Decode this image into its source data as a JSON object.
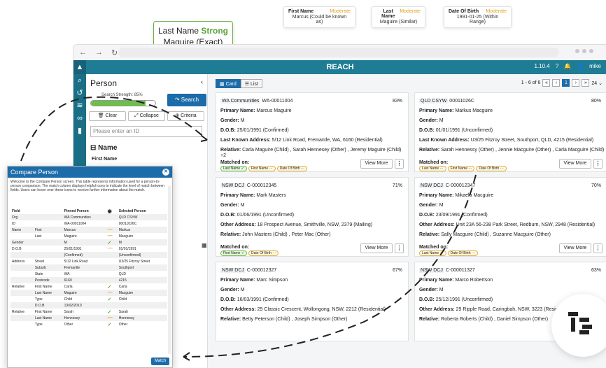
{
  "callouts": {
    "first_name": {
      "label": "First Name",
      "level": "Moderate",
      "value": "Marcus (Could be known as)"
    },
    "last_name": {
      "label": "Last Name",
      "level": "Moderate",
      "value": "Maguire    (Similar)"
    },
    "dob": {
      "label": "Date Of Birth",
      "level": "Moderate",
      "value": "1991-01-25 (Within Range)"
    },
    "last_name_strong": {
      "label": "Last Name",
      "level": "Strong",
      "value": "Maguire    (Exact)"
    }
  },
  "app": {
    "title": "REACH",
    "version": "1.10.4",
    "user": "mike",
    "accent": "#1e7d95"
  },
  "person_panel": {
    "title": "Person",
    "search_strength_label": "Search Strength: 85%",
    "search_strength": 85,
    "search_label": "Search",
    "clear_label": "Clear",
    "collapse_label": "Collapse",
    "criteria_label": "Criteria",
    "id_placeholder": "Please enter an ID",
    "name_section": "Name",
    "first_name_label": "First Name"
  },
  "results": {
    "card_label": "Card",
    "list_label": "List",
    "range": "1 - 6 of 6",
    "page": "1",
    "per_page": "24",
    "view_more": "View More",
    "matched_on": "Matched on:",
    "cards": [
      {
        "org": "WA Communities",
        "id": "WA-00011004",
        "pct": "83%",
        "primary": "Marcus Maguire",
        "gender": "M",
        "dob": "25/01/1991 (Confirmed)",
        "addr_label": "Last Known Address:",
        "addr": "5/12 Link Road, Fremantle, WA, 6160 (Residential)",
        "relative": "Carla Maguire (Child) , Sarah Hennesey (Other) , Jeremy Maguire (Child) +2",
        "chips": [
          "Last Name ✓",
          "First Name ⋯",
          "Date Of Birth ⋯"
        ]
      },
      {
        "org": "QLD CSYW",
        "id": "00011026C",
        "pct": "80%",
        "primary": "Markus Macguire",
        "gender": "M",
        "dob": "01/01/1991 (Unconfirmed)",
        "addr_label": "Last Known Address:",
        "addr": "U3/25 Fitzroy Street, Southport, QLD, 4215 (Residential)",
        "relative": "Sarah Hennessy (Other) , Jennie Macguire (Other) , Carla Macguire (Child)",
        "chips": [
          "Last Name ⋯",
          "First Name ⋯",
          "Date Of Birth ⋯"
        ]
      },
      {
        "org": "NSW DCJ",
        "id": "C-000012345",
        "pct": "71%",
        "primary": "Mark Masters",
        "gender": "M",
        "dob": "01/06/1991 (Unconfirmed)",
        "addr_label": "Other Address:",
        "addr": "18 Prospect Avenue, Smithville, NSW, 2379 (Mailing)",
        "relative": "John Masters (Child) , Peter Mac (Other)",
        "chips": [
          "First Name ✓",
          "Date Of Birth ⋯"
        ]
      },
      {
        "org": "NSW DCJ",
        "id": "C-000012347",
        "pct": "70%",
        "primary": "Mikaela Macguire",
        "gender": "M",
        "dob": "23/09/1991 (Confirmed)",
        "addr_label": "Other Address:",
        "addr": "Unit 23A 56-238 Park Street, Redburn, NSW, 2948 (Residential)",
        "relative": "Sally Macguire (Child) , Suzanne Macguire (Other)",
        "chips": [
          "Last Name ⋯",
          "Date Of Birth ⋯"
        ]
      },
      {
        "org": "NSW DCJ",
        "id": "C-000012327",
        "pct": "67%",
        "primary": "Marc Simpson",
        "gender": "M",
        "dob": "16/03/1991 (Confirmed)",
        "addr_label": "Other Address:",
        "addr": "29 Classic Crescent, Wollongong, NSW, 2212 (Residential)",
        "relative": "Betty Peterson (Child) , Joseph Simpson (Other)",
        "chips": []
      },
      {
        "org": "NSW DCJ",
        "id": "C-000011327",
        "pct": "63%",
        "primary": "Marco Robertson",
        "gender": "M",
        "dob": "25/12/1991 (Unconfirmed)",
        "addr_label": "Other Address:",
        "addr": "29 Ripple Road, Caringbah, NSW, 3223 (Residential)",
        "relative": "Roberta Roberts (Child) , Daniel Simpson (Other)",
        "chips": []
      }
    ]
  },
  "compare": {
    "title": "Compare Person",
    "intro": "Welcome to the Compare Person screen. This table represents information used for a person-to-person comparison. The match column displays helpful icons to indicate the level of match between fields. Users can hover over these icons to receive further information about the match.",
    "col_field": "Field",
    "col_pinned": "Pinned Person",
    "col_selected": "Selected Person",
    "match_label": "Match",
    "rows": [
      {
        "field": "Org",
        "sub": "",
        "pinned": "WA Communities",
        "m": "",
        "selected": "QLD CSYW"
      },
      {
        "field": "ID",
        "sub": "",
        "pinned": "WA-00011004",
        "m": "",
        "selected": "00011026C"
      },
      {
        "field": "Name",
        "sub": "First",
        "pinned": "Marcus",
        "m": "—",
        "selected": "Markus"
      },
      {
        "field": "",
        "sub": "Last",
        "pinned": "Maguire",
        "m": "—",
        "selected": "Macguire"
      },
      {
        "field": "Gender",
        "sub": "",
        "pinned": "M",
        "m": "✓",
        "selected": "M"
      },
      {
        "field": "D.O.B",
        "sub": "",
        "pinned": "25/01/1991",
        "m": "—",
        "selected": "01/01/1991"
      },
      {
        "field": "",
        "sub": "",
        "pinned": "(Confirmed)",
        "m": "",
        "selected": "(Unconfirmed)"
      },
      {
        "field": "Address",
        "sub": "Street",
        "pinned": "5/12 Link Road",
        "m": "",
        "selected": "U3/25 Fitzroy Street"
      },
      {
        "field": "",
        "sub": "Suburb",
        "pinned": "Fremantle",
        "m": "",
        "selected": "Southport"
      },
      {
        "field": "",
        "sub": "State",
        "pinned": "WA",
        "m": "",
        "selected": "QLD"
      },
      {
        "field": "",
        "sub": "Postcode",
        "pinned": "6160",
        "m": "",
        "selected": "4215"
      },
      {
        "field": "Relative",
        "sub": "First Name",
        "pinned": "Carla",
        "m": "✓",
        "selected": "Carla"
      },
      {
        "field": "",
        "sub": "Last Name",
        "pinned": "Maguire",
        "m": "—",
        "selected": "Macguire"
      },
      {
        "field": "",
        "sub": "Type",
        "pinned": "Child",
        "m": "✓",
        "selected": "Child"
      },
      {
        "field": "",
        "sub": "D.O.B",
        "pinned": "13/02/2010",
        "m": "",
        "selected": ""
      },
      {
        "field": "Relative",
        "sub": "First Name",
        "pinned": "Sarah",
        "m": "✓",
        "selected": "Sarah"
      },
      {
        "field": "",
        "sub": "Last Name",
        "pinned": "Hennesey",
        "m": "—",
        "selected": "Hennessy"
      },
      {
        "field": "",
        "sub": "Type",
        "pinned": "Other",
        "m": "✓",
        "selected": "Other"
      }
    ]
  }
}
